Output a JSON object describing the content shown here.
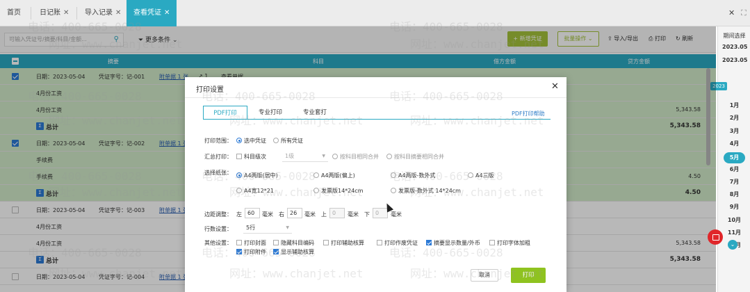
{
  "tabs": [
    {
      "label": "首页",
      "closable": false,
      "active": false
    },
    {
      "label": "日记账",
      "closable": true,
      "active": false
    },
    {
      "label": "导入记录",
      "closable": true,
      "active": false
    },
    {
      "label": "查看凭证",
      "closable": true,
      "active": true
    }
  ],
  "window_controls": {
    "close": "✕",
    "maximize": "⛶"
  },
  "toolbar": {
    "search_placeholder": "可输入凭证号/摘要/科目/金额...",
    "more_filter": "更多条件",
    "new_voucher": "+ 新增凭证",
    "batch_ops": "批量操作",
    "import_export": "导入/导出",
    "print": "打印",
    "refresh": "刷新"
  },
  "table": {
    "headers": [
      "摘要",
      "科目",
      "借方金额",
      "贷方金额"
    ],
    "rows": [
      {
        "type": "voucher",
        "checked": true,
        "color": "green",
        "date": "日期：2023-05-04",
        "number": "凭证字号：记-001",
        "attach": "附单据 1 张",
        "extra": "↗ 1",
        "subject": "查看单据"
      },
      {
        "type": "line",
        "color": "green",
        "summary": "4月份工资",
        "debit": "",
        "credit": ""
      },
      {
        "type": "line",
        "color": "green",
        "summary": "4月份工资",
        "debit": "5,343.58",
        "credit": ""
      },
      {
        "type": "total",
        "color": "green",
        "label": "总计",
        "amount": "5,343.58"
      },
      {
        "type": "voucher",
        "checked": true,
        "color": "green",
        "date": "日期：2023-05-04",
        "number": "凭证字号：记-002",
        "attach": "附单据 1 张"
      },
      {
        "type": "line",
        "color": "green",
        "summary": "手续费",
        "debit": "",
        "credit": ""
      },
      {
        "type": "line",
        "color": "green",
        "summary": "手续费",
        "debit": "4.50",
        "credit": ""
      },
      {
        "type": "total",
        "color": "green",
        "label": "总计",
        "amount": "4.50"
      },
      {
        "type": "voucher",
        "checked": false,
        "color": "white",
        "date": "日期：2023-05-04",
        "number": "凭证字号：记-003",
        "attach": "附单据 1 张"
      },
      {
        "type": "line",
        "color": "white",
        "summary": "4月份工资",
        "debit": "",
        "credit": ""
      },
      {
        "type": "line",
        "color": "white",
        "summary": "4月份工资",
        "debit": "5,343.58",
        "credit": ""
      },
      {
        "type": "total",
        "color": "white",
        "label": "总计",
        "amount": "5,343.58"
      },
      {
        "type": "voucher",
        "checked": false,
        "color": "white",
        "date": "日期：2023-05-04",
        "number": "凭证字号：记-004",
        "attach": "附单据 1 张"
      }
    ]
  },
  "period_panel": {
    "label": "期间选择",
    "start": "2023.05",
    "end": "2023.05",
    "year_badge": "2023",
    "months": [
      "1月",
      "2月",
      "3月",
      "4月",
      "5月",
      "6月",
      "7月",
      "8月",
      "9月",
      "10月",
      "11月",
      "12月"
    ],
    "selected_month": "5月"
  },
  "dialog": {
    "title": "打印设置",
    "tabs": [
      "PDF打印",
      "专业打印",
      "专业套打"
    ],
    "active_tab": "PDF打印",
    "help": "PDF打印帮助",
    "print_range": {
      "label": "打印范围：",
      "options": [
        "选中凭证",
        "所有凭证"
      ],
      "selected": "选中凭证"
    },
    "summary_print": {
      "label": "汇总打印：",
      "checkbox": "科目级次",
      "level_value": "1级",
      "radios": [
        "按科目相同合并",
        "按科目摘要相同合并"
      ]
    },
    "paper": {
      "label": "选择纸张：",
      "options": [
        "A4两版(居中)",
        "A4两版(偏上)",
        "A4两版-数外式",
        "A4三版",
        "A4宽12*21",
        "发票版14*24cm",
        "发票版-数外式 14*24cm"
      ],
      "selected": "A4两版(居中)"
    },
    "margin": {
      "label": "边距调整：",
      "left_label": "左",
      "left": "60",
      "right_label": "右",
      "right": "26",
      "top_label": "上",
      "top": "0",
      "bottom_label": "下",
      "bottom": "0",
      "unit": "毫米"
    },
    "rows_setting": {
      "label": "行数设置：",
      "value": "5行"
    },
    "other": {
      "label": "其他设置：",
      "options": [
        {
          "label": "打印封面",
          "checked": false
        },
        {
          "label": "隐藏科目编码",
          "checked": false
        },
        {
          "label": "打印辅助核算",
          "checked": false
        },
        {
          "label": "打印作废凭证",
          "checked": false
        },
        {
          "label": "摘要显示数量/外币",
          "checked": true
        },
        {
          "label": "打印字体加粗",
          "checked": false
        },
        {
          "label": "打印附件",
          "checked": true
        },
        {
          "label": "显示辅助核算",
          "checked": true
        }
      ]
    },
    "cancel": "取消",
    "print": "打印"
  },
  "watermarks": {
    "phone": "电话：400-665-0028",
    "site": "网址：www.chanjet.net"
  },
  "colors": {
    "accent": "#2aa9c2",
    "green_button": "#8fc31f",
    "selected_row": "#d2ebc9"
  }
}
